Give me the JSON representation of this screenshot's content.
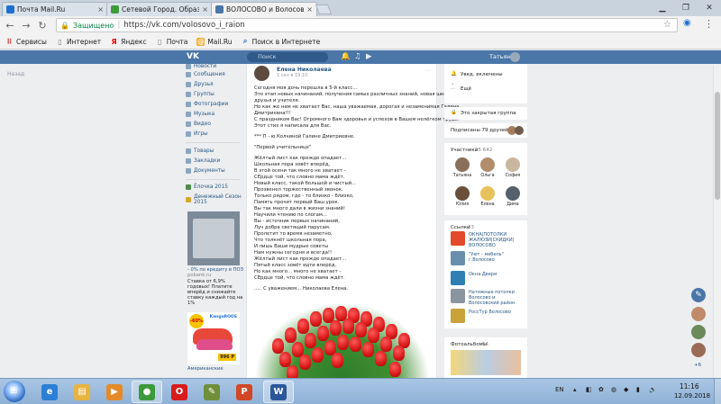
{
  "browser": {
    "tabs": [
      {
        "title": "Почта Mail.Ru",
        "active": false,
        "color": "#1f6fd1"
      },
      {
        "title": "Сетевой Город. Образо",
        "active": false,
        "color": "#3d9b3a"
      },
      {
        "title": "ВОЛОСОВО и Волосовс",
        "active": true,
        "color": "#4a76a8"
      }
    ],
    "close_glyph": "×",
    "secure_label": "Защищено",
    "url": "https://vk.com/volosovo_i_raion",
    "bookmarks": [
      {
        "label": "Сервисы",
        "icon": "apps-grid-icon"
      },
      {
        "label": "Интернет",
        "icon": "page-icon"
      },
      {
        "label": "Яндекс",
        "icon": "yandex-icon"
      },
      {
        "label": "Почта",
        "icon": "page-icon"
      },
      {
        "label": "Mail.Ru",
        "icon": "mailru-icon"
      },
      {
        "label": "Поиск в Интернете",
        "icon": "search-icon"
      }
    ]
  },
  "vk": {
    "logo": "VK",
    "search_placeholder": "Поиск",
    "user_name": "Татьяна",
    "back_link": "Назад",
    "left_menu": [
      {
        "label": "Новости"
      },
      {
        "label": "Сообщения"
      },
      {
        "label": "Друзья"
      },
      {
        "label": "Группы"
      },
      {
        "label": "Фотографии"
      },
      {
        "label": "Музыка"
      },
      {
        "label": "Видео"
      },
      {
        "label": "Игры"
      },
      {
        "label": "Товары"
      },
      {
        "label": "Закладки"
      },
      {
        "label": "Документы"
      },
      {
        "label": "Ёлочка 2015"
      },
      {
        "label": "Денежный Сезон 2015"
      }
    ],
    "ads": {
      "ad1_lines": [
        "- 0% по кредиту в ПОЗ",
        "pobank.ru",
        "Ставка от 6,9%",
        "годовых! Платите",
        "вперёд и снижайте",
        "ставку каждый год на",
        "1%"
      ],
      "ad2_badge": "-60%",
      "ad2_brand": "KangaROOS",
      "ad2_price": "996 Р",
      "ad2_label": "Американские"
    },
    "post": {
      "author": "Елена Николаева",
      "date": "1 сен в 19:10",
      "more": "⋯",
      "lines": [
        "Сегодня моя дочь перешла в 5-й класс...",
        "Это этап новых начинаний, получения самых различных знаний, новая школа,",
        "друзья и учителя.",
        "Но как же нам не хватает Вас, наша уважаемая, дорогая и незаменимая Галина",
        "Дмитриевна!!!",
        "С праздником Вас! Огромного Вам здоровья и успехов в Вашем нелёгком труде.",
        "Этот стих я написала для Вас.",
        "",
        "*** П - ю Колчиной Галине Дмитриевне.",
        "",
        "\"Первой учительнице\"",
        "",
        "Жёлтый лист как прежде опадает...",
        "Школьная пора зовёт вперёд,",
        "В этой осени так много не хватает -",
        "СЕрдце той, что словно мама ждёт.",
        "Новый класс, такой большой и чистый...",
        "Прозвенел торжественный звонок.",
        "Только рядом, где - то близко - близко,",
        "Память прочит первый Ваш урок.",
        "Вы так много дали в жизни знаний!",
        "Научили чтению по слогам...",
        "Вы - источник первых начинаний,",
        "Луч добра светящий парусам.",
        "Пролетит то время незаметно,",
        "Что толкнёт школьная пора,",
        "И лишь Ваши мудрые советы",
        "Нам нужны сегодня и всегда!!",
        "Жёлтый лист как прежде опадает...",
        "Пятый класс зовёт идти вперёд.",
        "Но как много... много не хватает -",
        "СЕрдце той, что словно мама ждёт.",
        "",
        "..... С уважением... Николаева Елена."
      ]
    },
    "right": {
      "status": "Увед. включены",
      "more_menu": "Ещё",
      "closed_group": "Это закрытая группа",
      "friends_subscribed": "Подписаны 79 друзей",
      "members_title": "Участники",
      "members_count": "15 642",
      "members": [
        {
          "name": "Татьяна",
          "color": "#8a6f5a"
        },
        {
          "name": "Ольга",
          "color": "#b08d6b"
        },
        {
          "name": "София",
          "color": "#c9b7a1"
        },
        {
          "name": "Юлия",
          "color": "#6b4f3a"
        },
        {
          "name": "Елена",
          "color": "#e7c25b"
        },
        {
          "name": "Дима",
          "color": "#55606b"
        }
      ],
      "links_title": "Ссылки",
      "links_count": "23",
      "links": [
        {
          "title": "ОКНА|ПОТОЛКИ ЖАЛЮЗИ|СКИДКИ| ВОЛОСОВО",
          "color": "#e24a2b"
        },
        {
          "title": "\"Уют - мебель\" г.Волосово",
          "color": "#6a8fae"
        },
        {
          "title": "Окна Двери",
          "color": "#2f7fb5"
        },
        {
          "title": "Натяжные потолки Волосово и Волосовский район",
          "color": "#8a95a0"
        },
        {
          "title": "РоссТур Волосово",
          "color": "#c9a23a"
        }
      ],
      "photoalbums_title": "Фотоальбомы",
      "photoalbums_count": "94"
    },
    "dock": {
      "count": "+6"
    }
  },
  "taskbar": {
    "apps": [
      {
        "name": "ie",
        "glyph": "e",
        "color": "#2b7fd6"
      },
      {
        "name": "explorer",
        "glyph": "▤",
        "color": "#e7b341"
      },
      {
        "name": "media",
        "glyph": "▶",
        "color": "#e48a2a"
      },
      {
        "name": "chrome",
        "glyph": "●",
        "color": "#3c9a3d"
      },
      {
        "name": "opera",
        "glyph": "O",
        "color": "#d81b1b"
      },
      {
        "name": "tool",
        "glyph": "✎",
        "color": "#6f8f3a"
      },
      {
        "name": "powerpoint",
        "glyph": "P",
        "color": "#d24726"
      },
      {
        "name": "word",
        "glyph": "W",
        "color": "#2b579a"
      }
    ],
    "lang": "EN",
    "time": "11:16",
    "date": "12.09.2018"
  }
}
